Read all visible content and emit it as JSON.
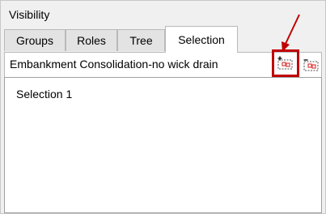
{
  "panel": {
    "title": "Visibility"
  },
  "tabs": [
    {
      "label": "Groups",
      "active": false
    },
    {
      "label": "Roles",
      "active": false
    },
    {
      "label": "Tree",
      "active": false
    },
    {
      "label": "Selection",
      "active": true
    }
  ],
  "header": {
    "title": "Embankment Consolidation-no wick drain",
    "buttons": [
      {
        "icon": "add-selection-icon",
        "highlighted": true
      },
      {
        "icon": "remove-selection-icon",
        "highlighted": false
      }
    ]
  },
  "list": {
    "items": [
      "Selection 1"
    ]
  },
  "colors": {
    "highlight": "#c00000",
    "icon_red": "#e04040",
    "icon_dash": "#505050"
  }
}
